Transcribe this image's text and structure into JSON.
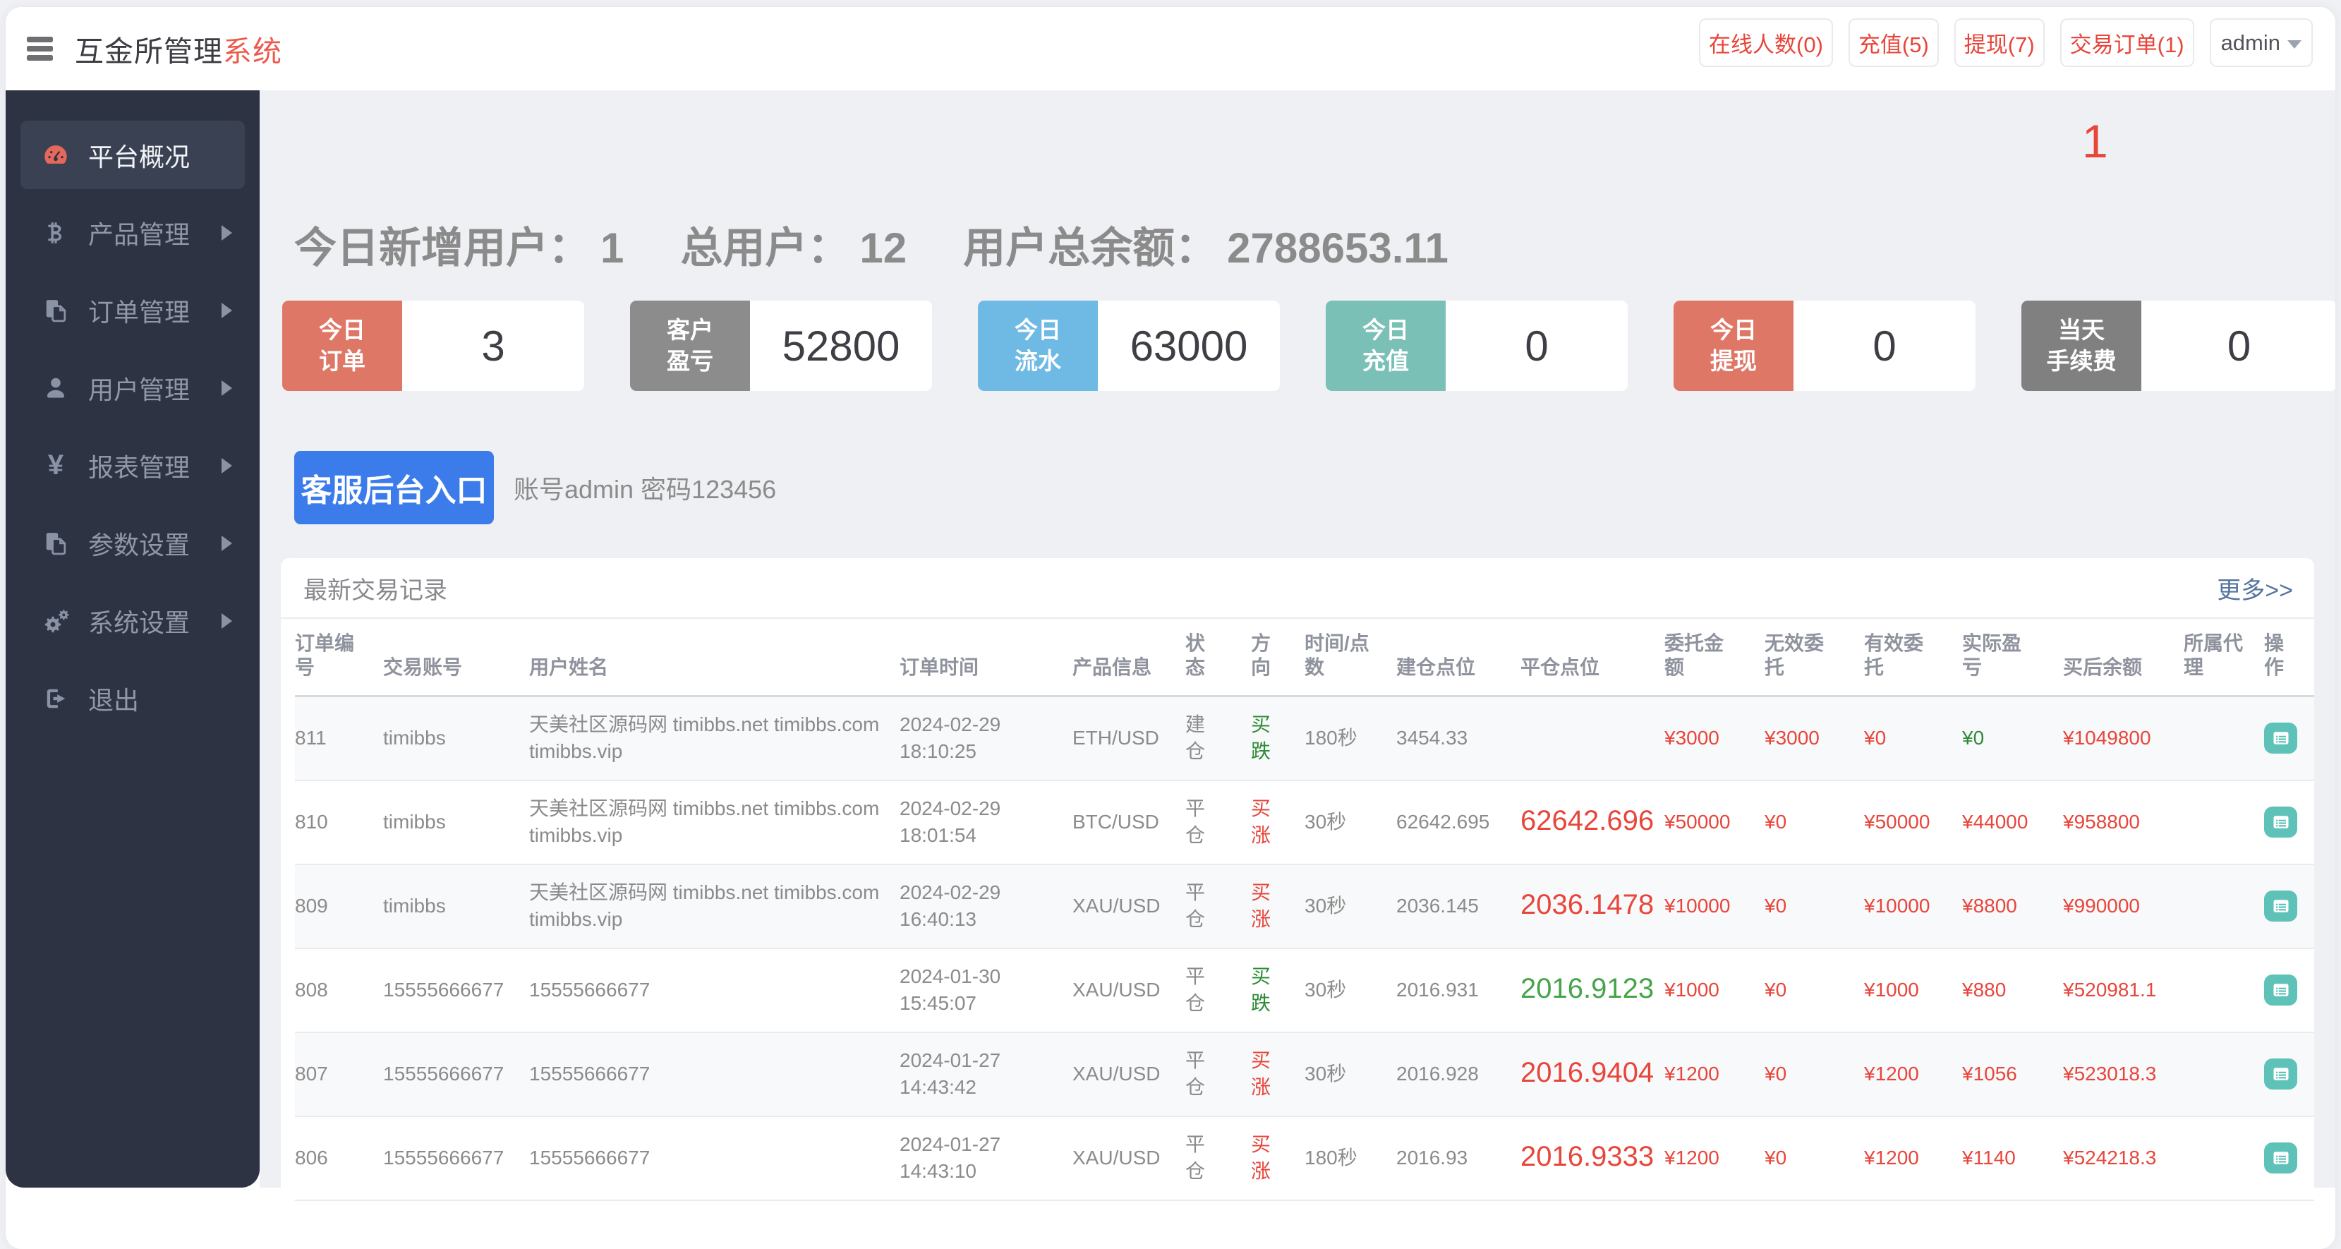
{
  "header": {
    "title_main": "互金所管理",
    "title_accent": "系统",
    "buttons": [
      {
        "label": "在线人数(0)"
      },
      {
        "label": "充值(5)"
      },
      {
        "label": "提现(7)"
      },
      {
        "label": "交易订单(1)"
      }
    ],
    "admin_label": "admin",
    "accent_color": "#e8453b"
  },
  "sidebar": {
    "items": [
      {
        "label": "平台概况",
        "icon": "dashboard-icon",
        "active": true
      },
      {
        "label": "产品管理",
        "icon": "bitcoin-icon",
        "active": false
      },
      {
        "label": "订单管理",
        "icon": "copy-icon",
        "active": false
      },
      {
        "label": "用户管理",
        "icon": "user-icon",
        "active": false
      },
      {
        "label": "报表管理",
        "icon": "yen-icon",
        "active": false
      },
      {
        "label": "参数设置",
        "icon": "copy-icon",
        "active": false
      },
      {
        "label": "系统设置",
        "icon": "gears-icon",
        "active": false
      },
      {
        "label": "退出",
        "icon": "signout-icon",
        "active": false
      }
    ]
  },
  "overview": {
    "badge": "1",
    "stats": [
      {
        "label": "今日新增用户：",
        "value": "1"
      },
      {
        "label": "总用户：",
        "value": "12"
      },
      {
        "label": "用户总余额：",
        "value": "2788653.11"
      }
    ],
    "cards": [
      {
        "line1": "今日",
        "line2": "订单",
        "value": "3",
        "color": "#df7767"
      },
      {
        "line1": "客户",
        "line2": "盈亏",
        "value": "52800",
        "color": "#8c8c8c"
      },
      {
        "line1": "今日",
        "line2": "流水",
        "value": "63000",
        "color": "#6fb9e5"
      },
      {
        "line1": "今日",
        "line2": "充值",
        "value": "0",
        "color": "#7bc0b7"
      },
      {
        "line1": "今日",
        "line2": "提现",
        "value": "0",
        "color": "#df7767"
      },
      {
        "line1": "当天",
        "line2": "手续费",
        "value": "0",
        "color": "#808080"
      }
    ],
    "service_button": "客服后台入口",
    "service_hint": "账号admin 密码123456",
    "panel": {
      "title": "最新交易记录",
      "more_link": "更多>>",
      "columns": [
        {
          "label": "订单编\n号"
        },
        {
          "label": "交易账号"
        },
        {
          "label": "用户姓名"
        },
        {
          "label": "订单时间"
        },
        {
          "label": "产品信息"
        },
        {
          "label": "状\n态"
        },
        {
          "label": "方\n向"
        },
        {
          "label": "时间/点\n数"
        },
        {
          "label": "建仓点位"
        },
        {
          "label": "平仓点位"
        },
        {
          "label": "委托金\n额"
        },
        {
          "label": "无效委\n托"
        },
        {
          "label": "有效委\n托"
        },
        {
          "label": "实际盈\n亏"
        },
        {
          "label": "买后余额"
        },
        {
          "label": "所属代\n理"
        },
        {
          "label": "操\n作"
        }
      ],
      "rows": [
        {
          "id": "811",
          "account": "timibbs",
          "name": "天美社区源码网 timibbs.net timibbs.com\ntimibbs.vip",
          "time": "2024-02-29\n18:10:25",
          "product": "ETH/USD",
          "status": "建\n仓",
          "dir": "买\n跌",
          "dir_color": "#2e8b36",
          "duration": "180秒",
          "open": "3454.33",
          "close": "",
          "close_color": "#e8453b",
          "entrust": "¥3000",
          "invalid": "¥3000",
          "valid": "¥0",
          "profit": "¥0",
          "profit_color": "#2e8b36",
          "balance": "¥1049800",
          "agent": ""
        },
        {
          "id": "810",
          "account": "timibbs",
          "name": "天美社区源码网 timibbs.net timibbs.com\ntimibbs.vip",
          "time": "2024-02-29\n18:01:54",
          "product": "BTC/USD",
          "status": "平\n仓",
          "dir": "买\n涨",
          "dir_color": "#e8453b",
          "duration": "30秒",
          "open": "62642.695",
          "close": "62642.696",
          "close_color": "#e8453b",
          "entrust": "¥50000",
          "invalid": "¥0",
          "valid": "¥50000",
          "profit": "¥44000",
          "profit_color": "#e8453b",
          "balance": "¥958800",
          "agent": ""
        },
        {
          "id": "809",
          "account": "timibbs",
          "name": "天美社区源码网 timibbs.net timibbs.com\ntimibbs.vip",
          "time": "2024-02-29\n16:40:13",
          "product": "XAU/USD",
          "status": "平\n仓",
          "dir": "买\n涨",
          "dir_color": "#e8453b",
          "duration": "30秒",
          "open": "2036.145",
          "close": "2036.1478",
          "close_color": "#e8453b",
          "entrust": "¥10000",
          "invalid": "¥0",
          "valid": "¥10000",
          "profit": "¥8800",
          "profit_color": "#e8453b",
          "balance": "¥990000",
          "agent": ""
        },
        {
          "id": "808",
          "account": "15555666677",
          "name": "15555666677",
          "time": "2024-01-30\n15:45:07",
          "product": "XAU/USD",
          "status": "平\n仓",
          "dir": "买\n跌",
          "dir_color": "#2e8b36",
          "duration": "30秒",
          "open": "2016.931",
          "close": "2016.9123",
          "close_color": "#46a449",
          "entrust": "¥1000",
          "invalid": "¥0",
          "valid": "¥1000",
          "profit": "¥880",
          "profit_color": "#e8453b",
          "balance": "¥520981.1",
          "agent": ""
        },
        {
          "id": "807",
          "account": "15555666677",
          "name": "15555666677",
          "time": "2024-01-27\n14:43:42",
          "product": "XAU/USD",
          "status": "平\n仓",
          "dir": "买\n涨",
          "dir_color": "#e8453b",
          "duration": "30秒",
          "open": "2016.928",
          "close": "2016.9404",
          "close_color": "#e8453b",
          "entrust": "¥1200",
          "invalid": "¥0",
          "valid": "¥1200",
          "profit": "¥1056",
          "profit_color": "#e8453b",
          "balance": "¥523018.3",
          "agent": ""
        },
        {
          "id": "806",
          "account": "15555666677",
          "name": "15555666677",
          "time": "2024-01-27\n14:43:10",
          "product": "XAU/USD",
          "status": "平\n仓",
          "dir": "买\n涨",
          "dir_color": "#e8453b",
          "duration": "180秒",
          "open": "2016.93",
          "close": "2016.9333",
          "close_color": "#e8453b",
          "entrust": "¥1200",
          "invalid": "¥0",
          "valid": "¥1200",
          "profit": "¥1140",
          "profit_color": "#e8453b",
          "balance": "¥524218.3",
          "agent": ""
        }
      ]
    }
  }
}
